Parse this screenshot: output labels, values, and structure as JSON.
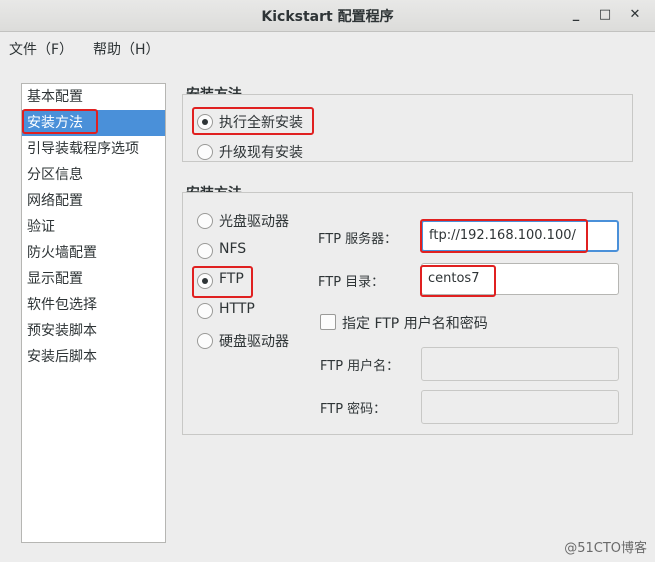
{
  "window": {
    "title": "Kickstart 配置程序",
    "minimize_glyph": "_",
    "maximize_glyph": "□",
    "close_glyph": "✕"
  },
  "menu": [
    {
      "label": "文件（F）"
    },
    {
      "label": "帮助（H）"
    }
  ],
  "sidebar": {
    "items": [
      {
        "label": "基本配置"
      },
      {
        "label": "安装方法",
        "selected": true
      },
      {
        "label": "引导装载程序选项"
      },
      {
        "label": "分区信息"
      },
      {
        "label": "网络配置"
      },
      {
        "label": "验证"
      },
      {
        "label": "防火墙配置"
      },
      {
        "label": "显示配置"
      },
      {
        "label": "软件包选择"
      },
      {
        "label": "预安装脚本"
      },
      {
        "label": "安装后脚本"
      }
    ]
  },
  "install_type": {
    "title": "安装方法",
    "options": [
      {
        "label": "执行全新安装",
        "checked": true
      },
      {
        "label": "升级现有安装",
        "checked": false
      }
    ]
  },
  "install_method": {
    "title": "安装方法",
    "options": [
      {
        "label": "光盘驱动器",
        "checked": false
      },
      {
        "label": "NFS",
        "checked": false
      },
      {
        "label": "FTP",
        "checked": true
      },
      {
        "label": "HTTP",
        "checked": false
      },
      {
        "label": "硬盘驱动器",
        "checked": false
      }
    ],
    "ftp_server_label": "FTP 服务器：",
    "ftp_server_value": "ftp://192.168.100.100/",
    "ftp_dir_label": "FTP 目录：",
    "ftp_dir_value": "centos7",
    "credentials_checkbox_label": "指定  FTP 用户名和密码",
    "credentials_checked": false,
    "ftp_user_label": "FTP 用户名：",
    "ftp_user_value": "",
    "ftp_password_label": "FTP 密码：",
    "ftp_password_value": ""
  },
  "watermark": "@51CTO博客",
  "colors": {
    "selection": "#4a90d9",
    "highlight_box": "#e02020"
  }
}
